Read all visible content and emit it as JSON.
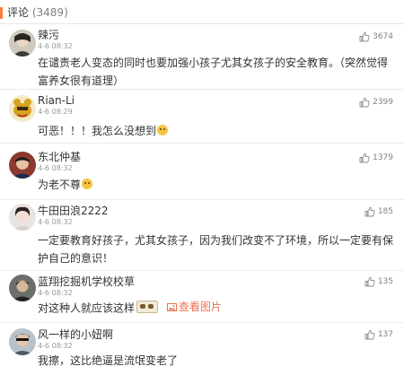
{
  "header": {
    "title": "评论",
    "count": "(3489)"
  },
  "colors": {
    "accent": "#fa7d3c",
    "link": "#eb7350",
    "muted": "#999999"
  },
  "comments": [
    {
      "username": "辣污",
      "time": "4-6 08:32",
      "likes": "3674",
      "text": "在谴责老人变态的同时也要加强小孩子尤其女孩子的安全教育。（突然觉得富养女很有道理）"
    },
    {
      "username": "Rian-Li",
      "time": "4-6 08:29",
      "likes": "2399",
      "text": "可恶！！！我怎么没想到"
    },
    {
      "username": "东北仲基",
      "time": "4-6 08:32",
      "likes": "1379",
      "text": "为老不尊"
    },
    {
      "username": "牛田田浪2222",
      "time": "4-6 08:32",
      "likes": "185",
      "text": "一定要教育好孩子，尤其女孩子，因为我们改变不了环境，所以一定要有保护自己的意识！"
    },
    {
      "username": "蓝翔挖掘机学校校草",
      "time": "4-6 08:32",
      "likes": "135",
      "text": "对这种人就应该这样",
      "link_text": "查看图片"
    },
    {
      "username": "风一样的小妞啊",
      "time": "4-6 08:32",
      "likes": "137",
      "text": "我擦，这比绝逼是流氓变老了"
    }
  ],
  "icons": {
    "like": "thumbs-up-icon",
    "image": "image-icon",
    "emoji": "emoji-icon",
    "sticker": "sticker-icon"
  }
}
